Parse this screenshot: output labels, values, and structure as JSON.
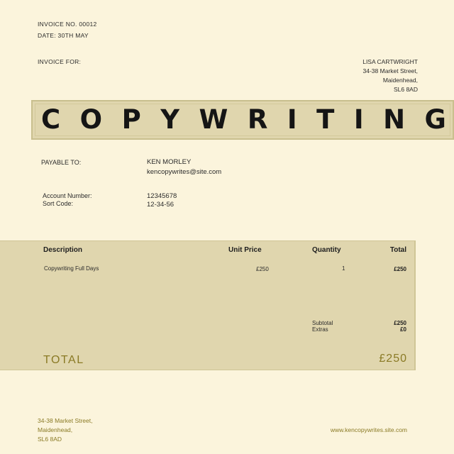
{
  "header": {
    "invoice_no": "INVOICE NO. 00012",
    "date": "DATE: 30TH MAY",
    "invoice_for_label": "INVOICE FOR:"
  },
  "bill_to": {
    "name": "LISA CARTWRIGHT",
    "street": "34-38 Market Street,",
    "town": "Maidenhead,",
    "postcode": "SL6 8AD"
  },
  "banner": {
    "title": "COPYWRITING"
  },
  "payable": {
    "label": "PAYABLE TO:",
    "name": "KEN MORLEY",
    "email": "kencopywrites@site.com",
    "account_label": "Account Number:",
    "sort_label": "Sort Code:",
    "account_number": "12345678",
    "sort_code": "12-34-56"
  },
  "table": {
    "headers": {
      "description": "Description",
      "unit_price": "Unit Price",
      "quantity": "Quantity",
      "total": "Total"
    },
    "rows": [
      {
        "description": "Copywriting Full Days",
        "unit_price": "£250",
        "quantity": "1",
        "total": "£250"
      }
    ],
    "subtotal_label": "Subtotal",
    "extras_label": "Extras",
    "subtotal_value": "£250",
    "extras_value": "£0",
    "total_label": "TOTAL",
    "total_value": "£250"
  },
  "footer": {
    "street": "34-38 Market Street,",
    "town": "Maidenhead,",
    "postcode": "SL6 8AD",
    "website": "www.kencopywrites.site.com"
  },
  "colors": {
    "background": "#fbf4dc",
    "band": "#e0d6ae",
    "accent_gold": "#8a7a25"
  }
}
